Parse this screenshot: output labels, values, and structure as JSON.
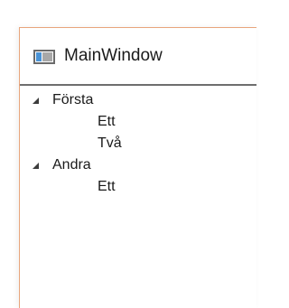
{
  "window": {
    "title": "MainWindow",
    "app_icon": "window-icon"
  },
  "tree": {
    "nodes": [
      {
        "label": "Första",
        "expanded": true,
        "expander_icon": "expanded-triangle-icon",
        "children": [
          {
            "label": "Ett"
          },
          {
            "label": "Två"
          }
        ]
      },
      {
        "label": "Andra",
        "expanded": true,
        "expander_icon": "expanded-triangle-icon",
        "children": [
          {
            "label": "Ett"
          }
        ]
      }
    ]
  },
  "colors": {
    "window_border": "#e8a57c",
    "divider": "#6e6e6e",
    "icon_accent": "#4a93d6",
    "text": "#1a1a1a"
  }
}
